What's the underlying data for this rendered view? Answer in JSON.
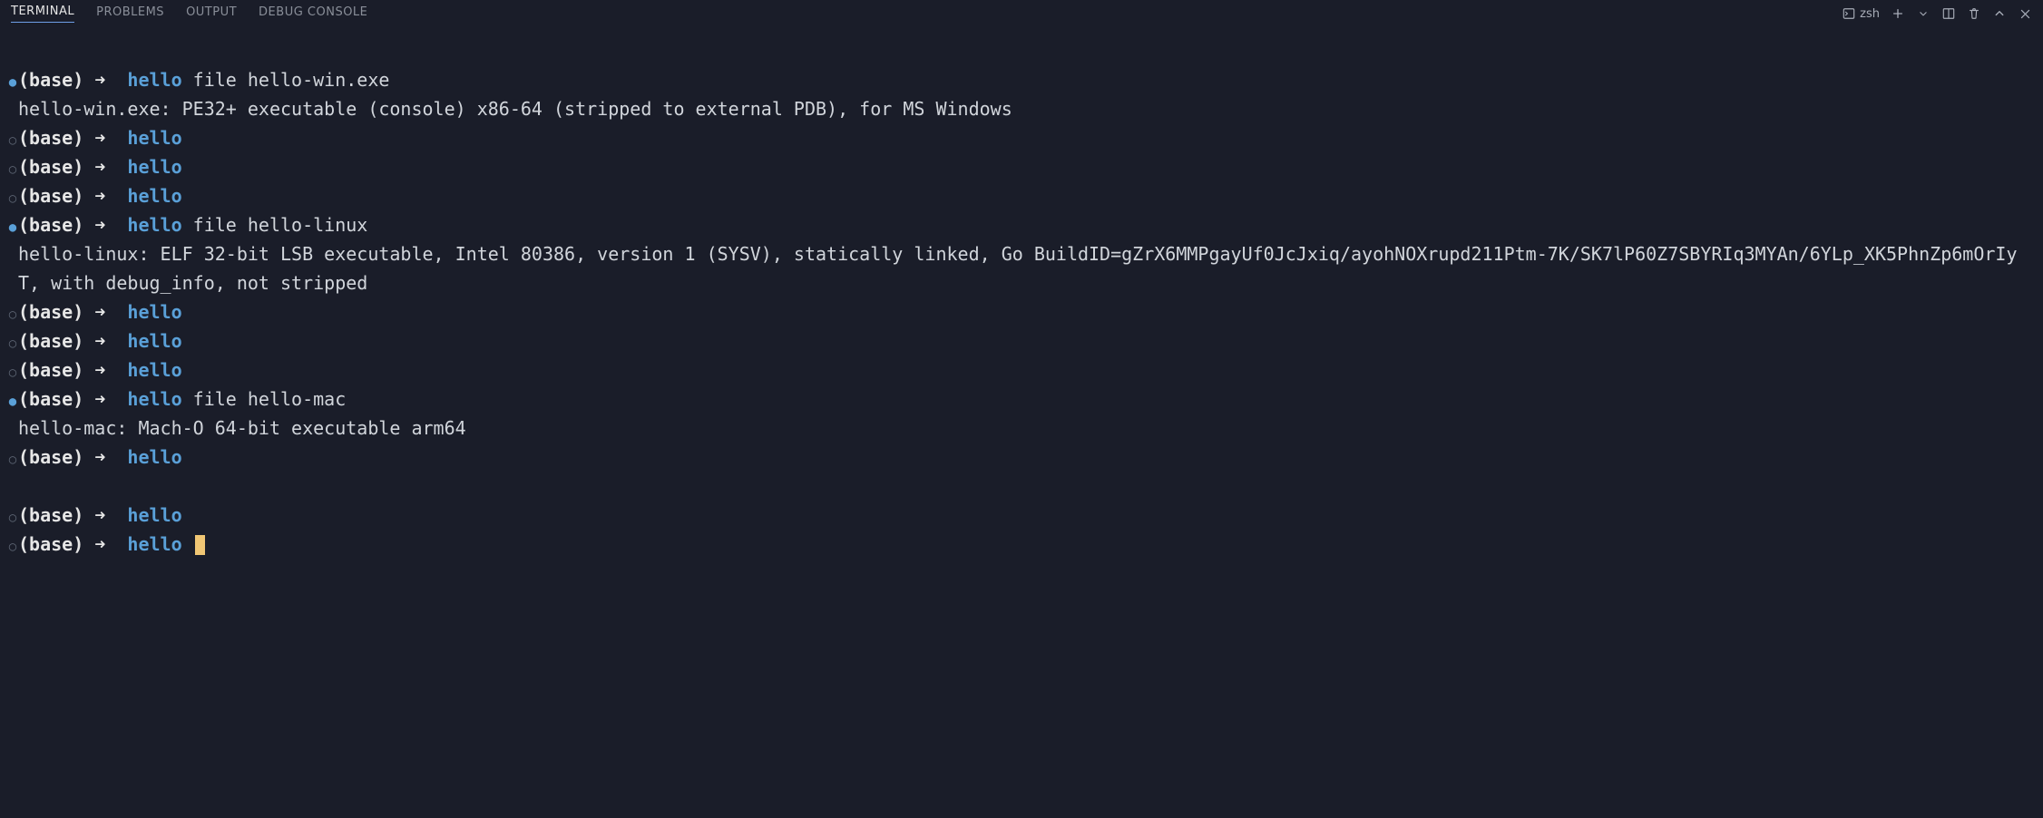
{
  "tabs": {
    "terminal": "TERMINAL",
    "problems": "PROBLEMS",
    "output": "OUTPUT",
    "debug_console": "DEBUG CONSOLE"
  },
  "toolbar": {
    "shell_label": "zsh"
  },
  "prompt": {
    "env": "(base)",
    "arrow": "➜",
    "dir": "hello"
  },
  "lines": [
    {
      "type": "prompt",
      "bullet": "filled",
      "cmd": "file hello-win.exe"
    },
    {
      "type": "output",
      "text": "hello-win.exe: PE32+ executable (console) x86-64 (stripped to external PDB), for MS Windows"
    },
    {
      "type": "prompt",
      "bullet": "hollow",
      "cmd": ""
    },
    {
      "type": "prompt",
      "bullet": "hollow",
      "cmd": ""
    },
    {
      "type": "prompt",
      "bullet": "hollow",
      "cmd": ""
    },
    {
      "type": "prompt",
      "bullet": "filled",
      "cmd": "file hello-linux"
    },
    {
      "type": "output",
      "text": "hello-linux: ELF 32-bit LSB executable, Intel 80386, version 1 (SYSV), statically linked, Go BuildID=gZrX6MMPgayUf0JcJxiq/ayohNOXrupd211Ptm-7K/SK7lP60Z7SBYRIq3MYAn/6YLp_XK5PhnZp6mOrIyT, with debug_info, not stripped"
    },
    {
      "type": "prompt",
      "bullet": "hollow",
      "cmd": ""
    },
    {
      "type": "prompt",
      "bullet": "hollow",
      "cmd": ""
    },
    {
      "type": "prompt",
      "bullet": "hollow",
      "cmd": ""
    },
    {
      "type": "prompt",
      "bullet": "filled",
      "cmd": "file hello-mac"
    },
    {
      "type": "output",
      "text": "hello-mac: Mach-O 64-bit executable arm64"
    },
    {
      "type": "prompt",
      "bullet": "hollow",
      "cmd": ""
    },
    {
      "type": "blank"
    },
    {
      "type": "prompt",
      "bullet": "hollow",
      "cmd": ""
    },
    {
      "type": "prompt",
      "bullet": "hollow",
      "cmd": "",
      "cursor": true
    }
  ]
}
